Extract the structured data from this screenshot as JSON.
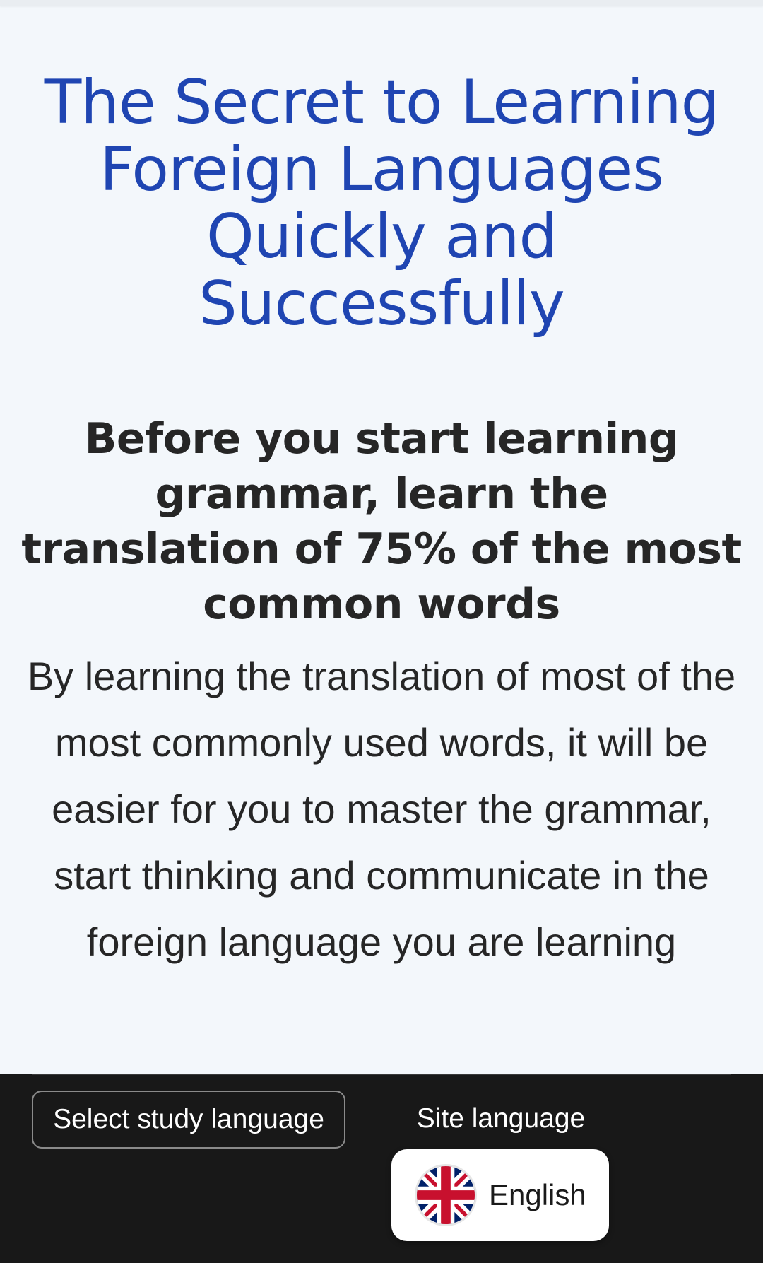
{
  "hero": {
    "title": "The Secret to Learning Foreign Languages Quickly and Successfully",
    "subtitle": "Before you start learning grammar, learn the translation of 75% of the most common words",
    "body": "By learning the translation of most of the most commonly used words, it will be easier for you to master the grammar, start thinking and communicate in the foreign language you are learning"
  },
  "footer": {
    "study_language_button": "Select study language",
    "site_language_label": "Site language",
    "site_language": {
      "name": "English",
      "flag_icon": "uk-flag-icon"
    }
  },
  "colors": {
    "title": "#1f45b2",
    "page_background": "#f3f7fb",
    "footer_background": "#181818"
  }
}
